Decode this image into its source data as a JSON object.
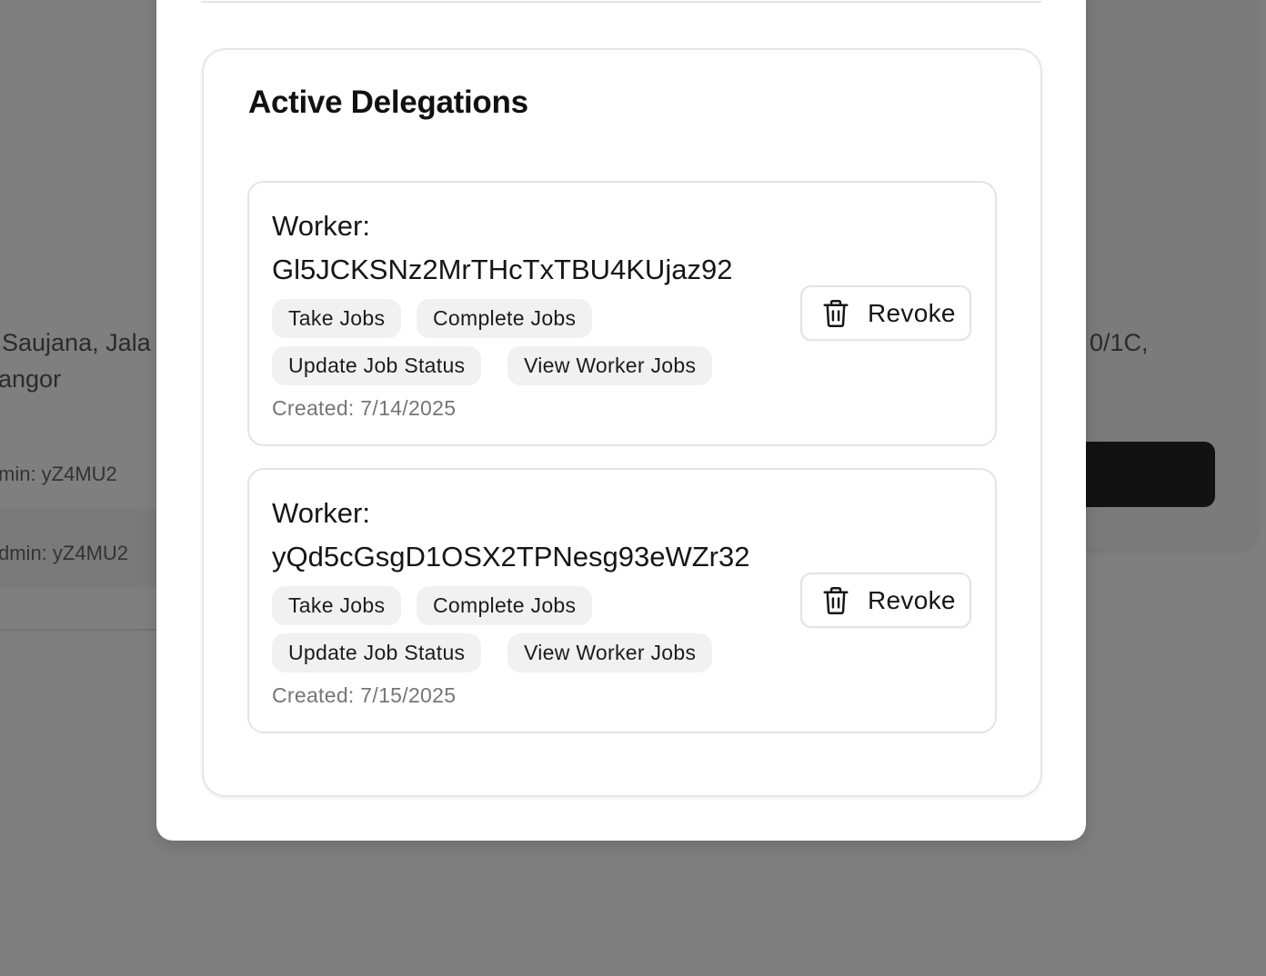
{
  "background": {
    "address_line_1": "Saujana, Jala",
    "address_line_2": "angor",
    "address_right": "0/1C,",
    "admin_row_1": "min: yZ4MU2",
    "admin_row_2": "dmin: yZ4MU2"
  },
  "modal": {
    "title": "Active Delegations",
    "delegations": [
      {
        "worker_label": "Worker:",
        "worker_id": "Gl5JCKSNz2MrTHcTxTBU4KUjaz92",
        "permissions": [
          "Take Jobs",
          "Complete Jobs",
          "Update Job Status",
          "View Worker Jobs"
        ],
        "created": "Created: 7/14/2025",
        "revoke_label": "Revoke",
        "revoke_icon": "trash-icon"
      },
      {
        "worker_label": "Worker:",
        "worker_id": "yQd5cGsgD1OSX2TPNesg93eWZr32",
        "permissions": [
          "Take Jobs",
          "Complete Jobs",
          "Update Job Status",
          "View Worker Jobs"
        ],
        "created": "Created: 7/15/2025",
        "revoke_label": "Revoke",
        "revoke_icon": "trash-icon"
      }
    ]
  }
}
